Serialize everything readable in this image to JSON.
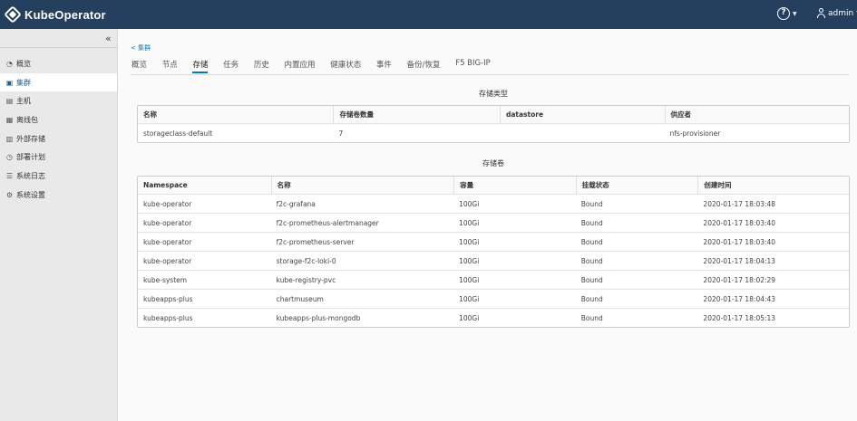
{
  "header": {
    "app_title": "KubeOperator",
    "user": "admin",
    "help_glyph": "?"
  },
  "sidebar": {
    "collapse_glyph": "«",
    "items": [
      {
        "label": "概览",
        "icon": "dashboard-icon",
        "active": false
      },
      {
        "label": "集群",
        "icon": "cluster-icon",
        "active": true
      },
      {
        "label": "主机",
        "icon": "host-icon",
        "active": false
      },
      {
        "label": "离线包",
        "icon": "package-icon",
        "active": false
      },
      {
        "label": "外部存储",
        "icon": "storage-icon",
        "active": false
      },
      {
        "label": "部署计划",
        "icon": "clock-icon",
        "active": false
      },
      {
        "label": "系统日志",
        "icon": "list-icon",
        "active": false
      },
      {
        "label": "系统设置",
        "icon": "gear-icon",
        "active": false
      }
    ]
  },
  "breadcrumb": "< 集群",
  "tabs": [
    "概览",
    "节点",
    "存储",
    "任务",
    "历史",
    "内置应用",
    "健康状态",
    "事件",
    "备份/恢复",
    "F5 BIG-IP"
  ],
  "active_tab": 2,
  "storage_classes": {
    "title": "存储类型",
    "columns": [
      "名称",
      "存储卷数量",
      "datastore",
      "供应者"
    ],
    "rows": [
      [
        "storageclass-default",
        "7",
        "",
        "nfs-provisioner"
      ]
    ]
  },
  "volumes": {
    "title": "存储卷",
    "columns": [
      "Namespace",
      "名称",
      "容量",
      "挂载状态",
      "创建时间"
    ],
    "rows": [
      [
        "kube-operator",
        "f2c-grafana",
        "100Gi",
        "Bound",
        "2020-01-17 18:03:48"
      ],
      [
        "kube-operator",
        "f2c-prometheus-alertmanager",
        "100Gi",
        "Bound",
        "2020-01-17 18:03:40"
      ],
      [
        "kube-operator",
        "f2c-prometheus-server",
        "100Gi",
        "Bound",
        "2020-01-17 18:03:40"
      ],
      [
        "kube-operator",
        "storage-f2c-loki-0",
        "100Gi",
        "Bound",
        "2020-01-17 18:04:13"
      ],
      [
        "kube-system",
        "kube-registry-pvc",
        "100Gi",
        "Bound",
        "2020-01-17 18:02:29"
      ],
      [
        "kubeapps-plus",
        "chartmuseum",
        "100Gi",
        "Bound",
        "2020-01-17 18:04:43"
      ],
      [
        "kubeapps-plus",
        "kubeapps-plus-mongodb",
        "100Gi",
        "Bound",
        "2020-01-17 18:05:13"
      ]
    ]
  },
  "colors": {
    "header_bg": "#25405f",
    "accent": "#0079b8",
    "sidebar_bg": "#e9e9e9"
  }
}
